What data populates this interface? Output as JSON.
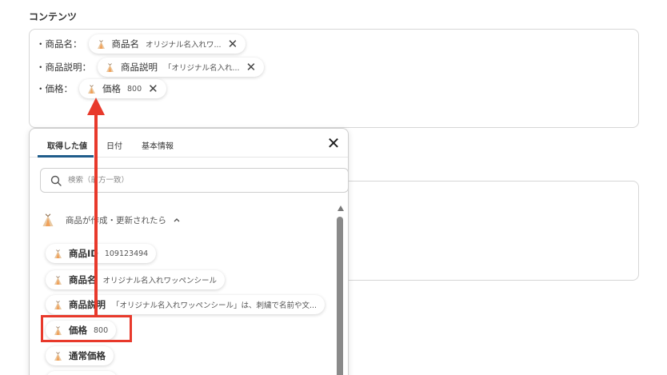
{
  "section": {
    "label": "コンテンツ"
  },
  "content": {
    "lines": [
      {
        "label": "・商品名：",
        "chip_name": "商品名",
        "chip_value": "オリジナル名入れワ..."
      },
      {
        "label": "・商品説明：",
        "chip_name": "商品説明",
        "chip_value": "「オリジナル名入れ..."
      },
      {
        "label": "・価格：",
        "chip_name": "価格",
        "chip_value": "800"
      }
    ]
  },
  "panel": {
    "tabs": [
      "取得した値",
      "日付",
      "基本情報"
    ],
    "active_tab": "取得した値",
    "search_placeholder": "検索（前方一致）",
    "group_title": "商品が作成・更新されたら",
    "items": [
      {
        "name": "商品ID",
        "value": "109123494"
      },
      {
        "name": "商品名",
        "value": "オリジナル名入れワッペンシール"
      },
      {
        "name": "商品説明",
        "value": "「オリジナル名入れワッペンシール」は、刺繍で名前や文..."
      },
      {
        "name": "価格",
        "value": "800"
      },
      {
        "name": "通常価格",
        "value": ""
      }
    ]
  },
  "colors": {
    "highlight": "#e8392b",
    "tab_underline": "#1f5c8b",
    "icon_orange": "#f0a15a"
  },
  "icons": {
    "item": "teepee-icon",
    "remove": "close-icon",
    "search": "search-icon",
    "collapse": "chevron-up-icon"
  }
}
